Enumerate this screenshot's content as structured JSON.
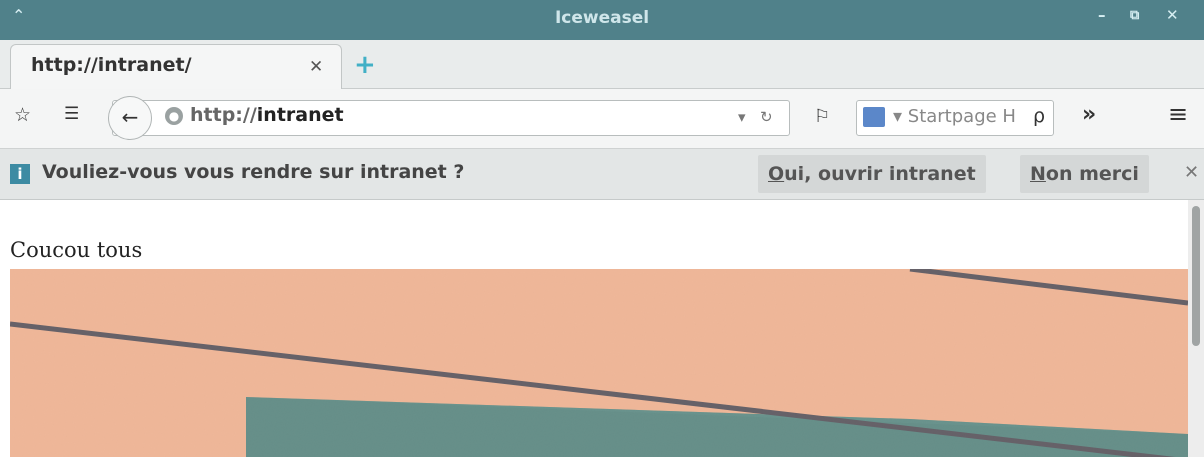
{
  "window": {
    "title": "Iceweasel",
    "caret_icon": "chevron-up-icon",
    "controls": [
      "minimize-icon",
      "restore-icon",
      "close-icon"
    ]
  },
  "tabs": [
    {
      "label": "http://intranet/"
    }
  ],
  "navbar": {
    "url_protocol": "http://",
    "url_host": "intranet",
    "search_placeholder": "Startpage H",
    "overflow_label": "»"
  },
  "infobar": {
    "message": "Vouliez-vous vous rendre sur intranet ?",
    "accept_prefix": "O",
    "accept_rest": "ui, ouvrir intranet",
    "decline_prefix": "N",
    "decline_rest": "on merci"
  },
  "page": {
    "greeting": "Coucou tous"
  },
  "colors": {
    "titlebar": "#50818a",
    "accent": "#42b0c6",
    "photo_background": "#f0b89a",
    "photo_overlay": "#1f7b82"
  }
}
